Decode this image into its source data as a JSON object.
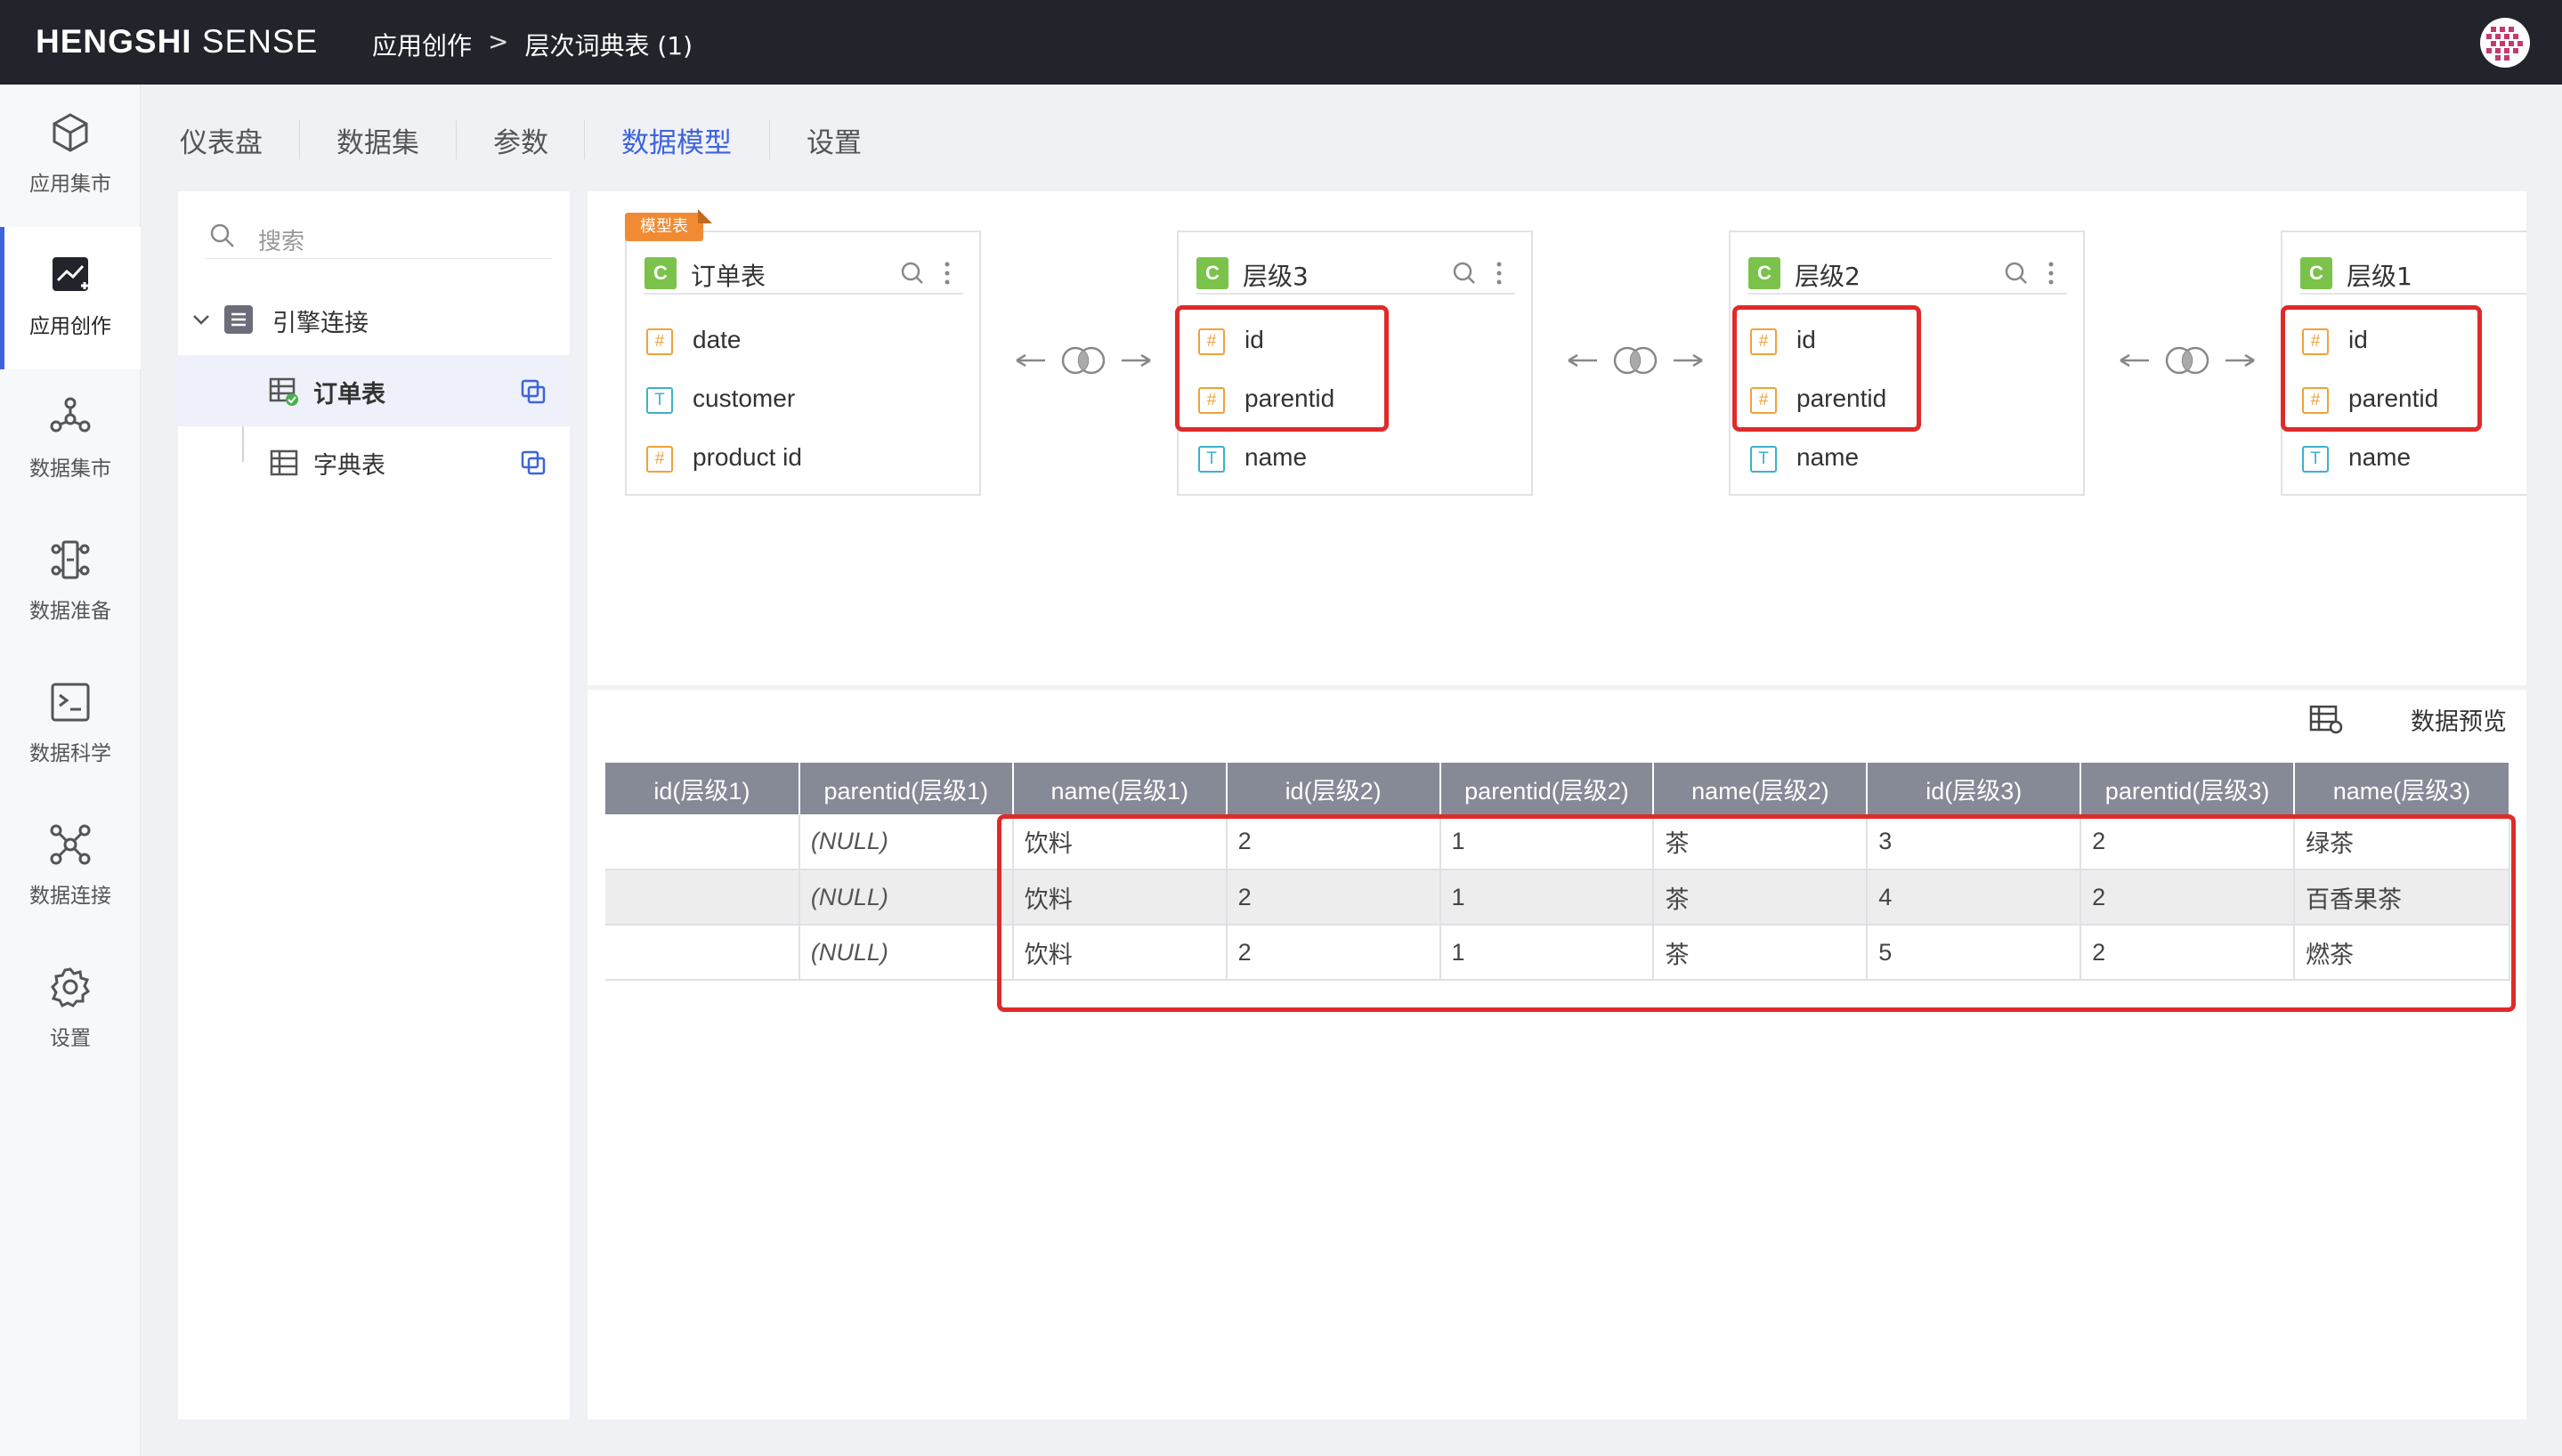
{
  "brand": {
    "bold": "HENGSHI",
    "light": "SENSE"
  },
  "breadcrumb": {
    "app": "应用创作",
    "sep": ">",
    "current": "层次词典表 (1)"
  },
  "rail": [
    {
      "label": "应用集市",
      "icon": "cube-icon"
    },
    {
      "label": "应用创作",
      "icon": "chart-edit-icon"
    },
    {
      "label": "数据集市",
      "icon": "network-icon"
    },
    {
      "label": "数据准备",
      "icon": "pipeline-icon"
    },
    {
      "label": "数据科学",
      "icon": "terminal-icon"
    },
    {
      "label": "数据连接",
      "icon": "connection-icon"
    },
    {
      "label": "设置",
      "icon": "gear-icon"
    }
  ],
  "tabs": [
    "仪表盘",
    "数据集",
    "参数",
    "数据模型",
    "设置"
  ],
  "active_tab": "数据模型",
  "left_panel": {
    "search_placeholder": "搜索",
    "group": "引擎连接",
    "tables": [
      "订单表",
      "字典表"
    ]
  },
  "model_tag": "模型表",
  "nodes": [
    {
      "badge": "C",
      "title": "订单表",
      "fields": [
        {
          "type": "#",
          "name": "date"
        },
        {
          "type": "T",
          "name": "customer"
        },
        {
          "type": "#",
          "name": "product id"
        }
      ]
    },
    {
      "badge": "C",
      "title": "层级3",
      "fields": [
        {
          "type": "#",
          "name": "id"
        },
        {
          "type": "#",
          "name": "parentid"
        },
        {
          "type": "T",
          "name": "name"
        }
      ]
    },
    {
      "badge": "C",
      "title": "层级2",
      "fields": [
        {
          "type": "#",
          "name": "id"
        },
        {
          "type": "#",
          "name": "parentid"
        },
        {
          "type": "T",
          "name": "name"
        }
      ]
    },
    {
      "badge": "C",
      "title": "层级1",
      "fields": [
        {
          "type": "#",
          "name": "id"
        },
        {
          "type": "#",
          "name": "parentid"
        },
        {
          "type": "T",
          "name": "name"
        }
      ]
    }
  ],
  "preview": {
    "title": "数据预览",
    "columns": [
      "id(层级1)",
      "parentid(层级1)",
      "name(层级1)",
      "id(层级2)",
      "parentid(层级2)",
      "name(层级2)",
      "id(层级3)",
      "parentid(层级3)",
      "name(层级3)"
    ],
    "rows": [
      [
        "",
        "(NULL)",
        "饮料",
        "2",
        "1",
        "茶",
        "3",
        "2",
        "绿茶"
      ],
      [
        "",
        "(NULL)",
        "饮料",
        "2",
        "1",
        "茶",
        "4",
        "2",
        "百香果茶"
      ],
      [
        "",
        "(NULL)",
        "饮料",
        "2",
        "1",
        "茶",
        "5",
        "2",
        "燃茶"
      ]
    ]
  },
  "colors": {
    "topbar": "#22232b",
    "accent": "#3d63dd",
    "highlight": "#e02a2a",
    "badge": "#7bc24b",
    "number_field": "#f0a23a",
    "text_field": "#3fb0c9"
  }
}
